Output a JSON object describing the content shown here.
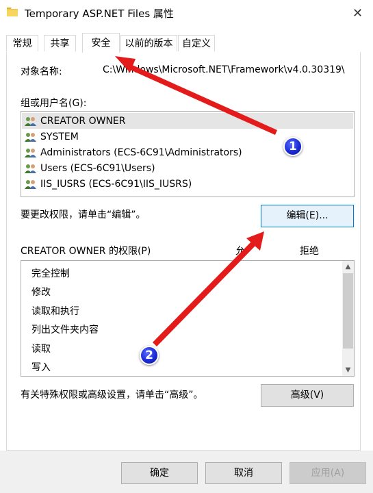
{
  "window": {
    "title": "Temporary ASP.NET Files 属性"
  },
  "tabs": [
    {
      "label": "常规"
    },
    {
      "label": "共享"
    },
    {
      "label": "安全"
    },
    {
      "label": "以前的版本"
    },
    {
      "label": "自定义"
    }
  ],
  "security": {
    "object_name_label": "对象名称:",
    "object_name_value": "C:\\Windows\\Microsoft.NET\\Framework\\v4.0.30319\\",
    "groups_label": "组或用户名(G):",
    "users": [
      {
        "label": "CREATOR OWNER",
        "selected": true
      },
      {
        "label": "SYSTEM"
      },
      {
        "label": "Administrators (ECS-6C91\\Administrators)"
      },
      {
        "label": "Users (ECS-6C91\\Users)"
      },
      {
        "label": "IIS_IUSRS (ECS-6C91\\IIS_IUSRS)"
      }
    ],
    "change_hint": "要更改权限，请单击“编辑”。",
    "edit_button": "编辑(E)...",
    "perm_label": "CREATOR OWNER 的权限(P)",
    "allow_col": "允",
    "deny_col": "拒绝",
    "permissions": [
      "完全控制",
      "修改",
      "读取和执行",
      "列出文件夹内容",
      "读取",
      "写入"
    ],
    "advanced_hint": "有关特殊权限或高级设置，请单击“高级”。",
    "advanced_button": "高级(V)"
  },
  "footer": {
    "ok": "确定",
    "cancel": "取消",
    "apply": "应用(A)"
  },
  "annotations": {
    "badge1": "1",
    "badge2": "2"
  },
  "colors": {
    "arrow": "#e41b1b",
    "badge": "#1a2bd6",
    "focus_border": "#0078d7"
  }
}
